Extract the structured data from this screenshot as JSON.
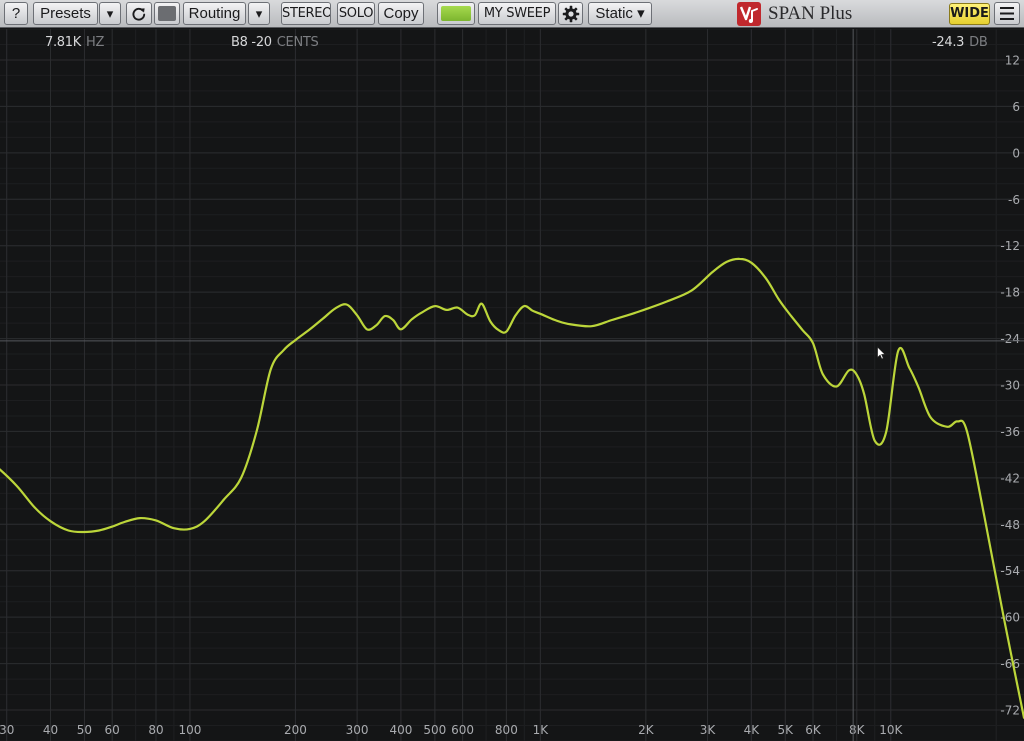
{
  "app": {
    "title": "SPAN Plus"
  },
  "toolbar": {
    "help": "?",
    "presets": "Presets",
    "dropdown_arrow": "▾",
    "routing": "Routing",
    "stereo": "STEREO",
    "solo": "SOLO",
    "copy": "Copy",
    "sweep": "MY SWEEP",
    "mode": "Static ▾",
    "wide": "WIDE"
  },
  "icons": {
    "reset": "reset-icon",
    "settings": "gear-icon",
    "menu": "hamburger-menu-icon",
    "logo": "voxengo-logo-icon",
    "cursor": "mouse-pointer-icon"
  },
  "colors": {
    "background": "#141516",
    "toolbar": "#c8cacd",
    "spectrum_line": "#bcd63a",
    "sweep_swatch": "#8cc63f",
    "inactive_swatch": "#6b6d71",
    "wide_button": "#f2e04a"
  },
  "readout": {
    "frequency": {
      "value": "7.81K",
      "unit": "HZ"
    },
    "note": {
      "value": "B8 -20",
      "unit": "CENTS"
    },
    "level": {
      "value": "-24.3",
      "unit": "DB"
    }
  },
  "cursor": {
    "freq_hz": 7810,
    "db": -24.3
  },
  "chart_data": {
    "type": "line",
    "x_scale": "log",
    "xlim": [
      20,
      24000
    ],
    "ylim": [
      -76,
      16
    ],
    "grid": true,
    "x_ticks": [
      {
        "label": "30",
        "value": 30
      },
      {
        "label": "40",
        "value": 40
      },
      {
        "label": "50",
        "value": 50
      },
      {
        "label": "60",
        "value": 60
      },
      {
        "label": "80",
        "value": 80
      },
      {
        "label": "100",
        "value": 100
      },
      {
        "label": "200",
        "value": 200
      },
      {
        "label": "300",
        "value": 300
      },
      {
        "label": "400",
        "value": 400
      },
      {
        "label": "500",
        "value": 500
      },
      {
        "label": "600",
        "value": 600
      },
      {
        "label": "800",
        "value": 800
      },
      {
        "label": "1K",
        "value": 1000
      },
      {
        "label": "2K",
        "value": 2000
      },
      {
        "label": "3K",
        "value": 3000
      },
      {
        "label": "4K",
        "value": 4000
      },
      {
        "label": "5K",
        "value": 5000
      },
      {
        "label": "6K",
        "value": 6000
      },
      {
        "label": "8K",
        "value": 8000
      },
      {
        "label": "10K",
        "value": 10000
      }
    ],
    "y_ticks": [
      12,
      6,
      0,
      -6,
      -12,
      -18,
      -24,
      -30,
      -36,
      -42,
      -48,
      -54,
      -60,
      -66,
      -72
    ],
    "series": [
      {
        "x": [
          20,
          22,
          25,
          28,
          32,
          36,
          40,
          45,
          50,
          55,
          60,
          65,
          72,
          80,
          90,
          100,
          110,
          125,
          140,
          155,
          170,
          185,
          200,
          220,
          240,
          260,
          280,
          300,
          320,
          340,
          360,
          380,
          400,
          430,
          460,
          500,
          540,
          580,
          620,
          650,
          680,
          720,
          760,
          800,
          850,
          900,
          950,
          1000,
          1100,
          1200,
          1400,
          1600,
          1800,
          2000,
          2300,
          2700,
          3100,
          3400,
          3700,
          4000,
          4400,
          4800,
          5200,
          5600,
          6000,
          6400,
          7000,
          7600,
          8000,
          8400,
          9000,
          9700,
          10500,
          11300,
          12000,
          13000,
          14500,
          15500,
          16500,
          18500,
          21000,
          24000
        ],
        "y": [
          -37,
          -37.6,
          -38.8,
          -40.5,
          -43,
          -45.8,
          -47.6,
          -48.8,
          -49,
          -48.8,
          -48.3,
          -47.7,
          -47.2,
          -47.5,
          -48.5,
          -48.6,
          -47.6,
          -44.8,
          -42,
          -36,
          -28,
          -25.5,
          -24.2,
          -22.8,
          -21.4,
          -20.1,
          -19.6,
          -21,
          -22.8,
          -22.3,
          -21.1,
          -21.6,
          -22.8,
          -21.5,
          -20.6,
          -19.8,
          -20.3,
          -20,
          -20.9,
          -21,
          -19.5,
          -21.8,
          -22.9,
          -23.1,
          -21,
          -19.8,
          -20.4,
          -20.8,
          -21.6,
          -22.1,
          -22.4,
          -21.6,
          -20.9,
          -20.2,
          -19.2,
          -17.8,
          -15.4,
          -14.1,
          -13.7,
          -14.2,
          -16.2,
          -19,
          -21.1,
          -22.9,
          -24.6,
          -28.6,
          -30.2,
          -28.1,
          -28.7,
          -31.2,
          -37.2,
          -36.1,
          -25.6,
          -27.8,
          -30.3,
          -34.2,
          -35.4,
          -34.7,
          -36,
          -47,
          -60,
          -73
        ]
      }
    ]
  }
}
